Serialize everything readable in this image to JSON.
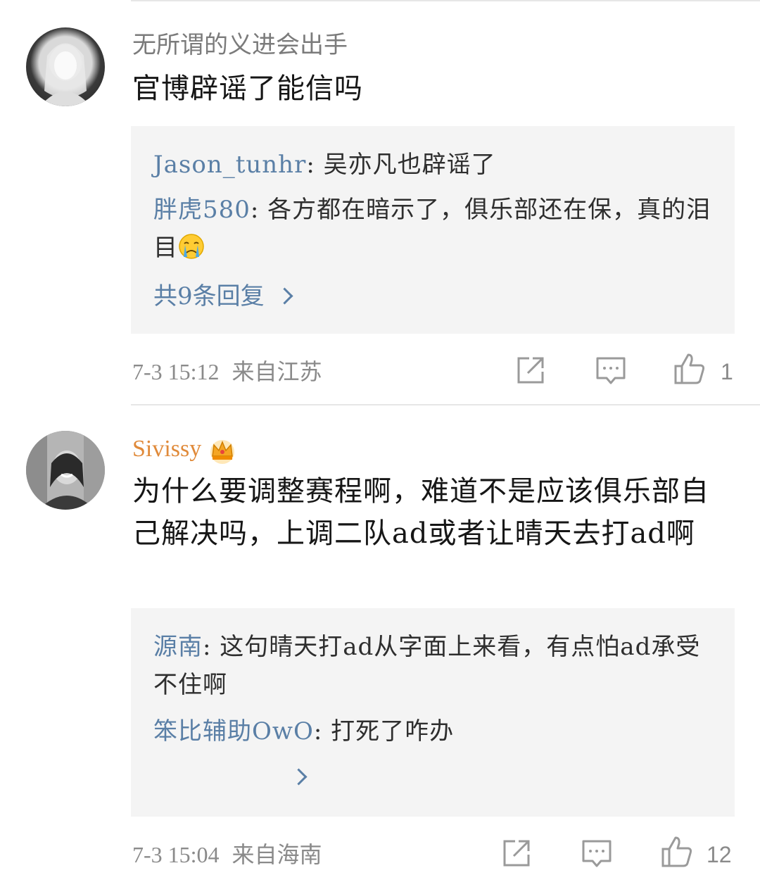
{
  "comments": [
    {
      "username": "无所谓的义进会出手",
      "text": "官博辟谣了能信吗",
      "replies": [
        {
          "author": "Jason_tunhr",
          "text": "吴亦凡也辟谣了"
        },
        {
          "author": "胖虎580",
          "text": "各方都在暗示了，俱乐部还在保，真的泪目"
        }
      ],
      "more_replies": "共9条回复",
      "time": "7-3 15:12",
      "location": "来自江苏",
      "likes": "1"
    },
    {
      "username": "Sivissy",
      "text": "为什么要调整赛程啊，难道不是应该俱乐部自己解决吗，上调二队ad或者让晴天去打ad啊",
      "replies": [
        {
          "author": "源南",
          "text": "这句晴天打ad从字面上来看，有点怕ad承受不住啊"
        },
        {
          "author": "笨比辅助OwO",
          "text": "打死了咋办"
        }
      ],
      "more_replies": "",
      "time": "7-3 15:04",
      "location": "来自海南",
      "likes": "12"
    }
  ],
  "icons": {
    "share": "share-icon",
    "comment": "comment-icon",
    "like": "thumbs-up-icon",
    "crying_emoji": "crying-face-emoji",
    "vip": "crown-icon"
  },
  "colors": {
    "link_blue": "#5a7fa6",
    "vip_orange": "#e08a3a",
    "meta_gray": "#8a8a8a",
    "reply_bg": "#f4f4f4"
  }
}
